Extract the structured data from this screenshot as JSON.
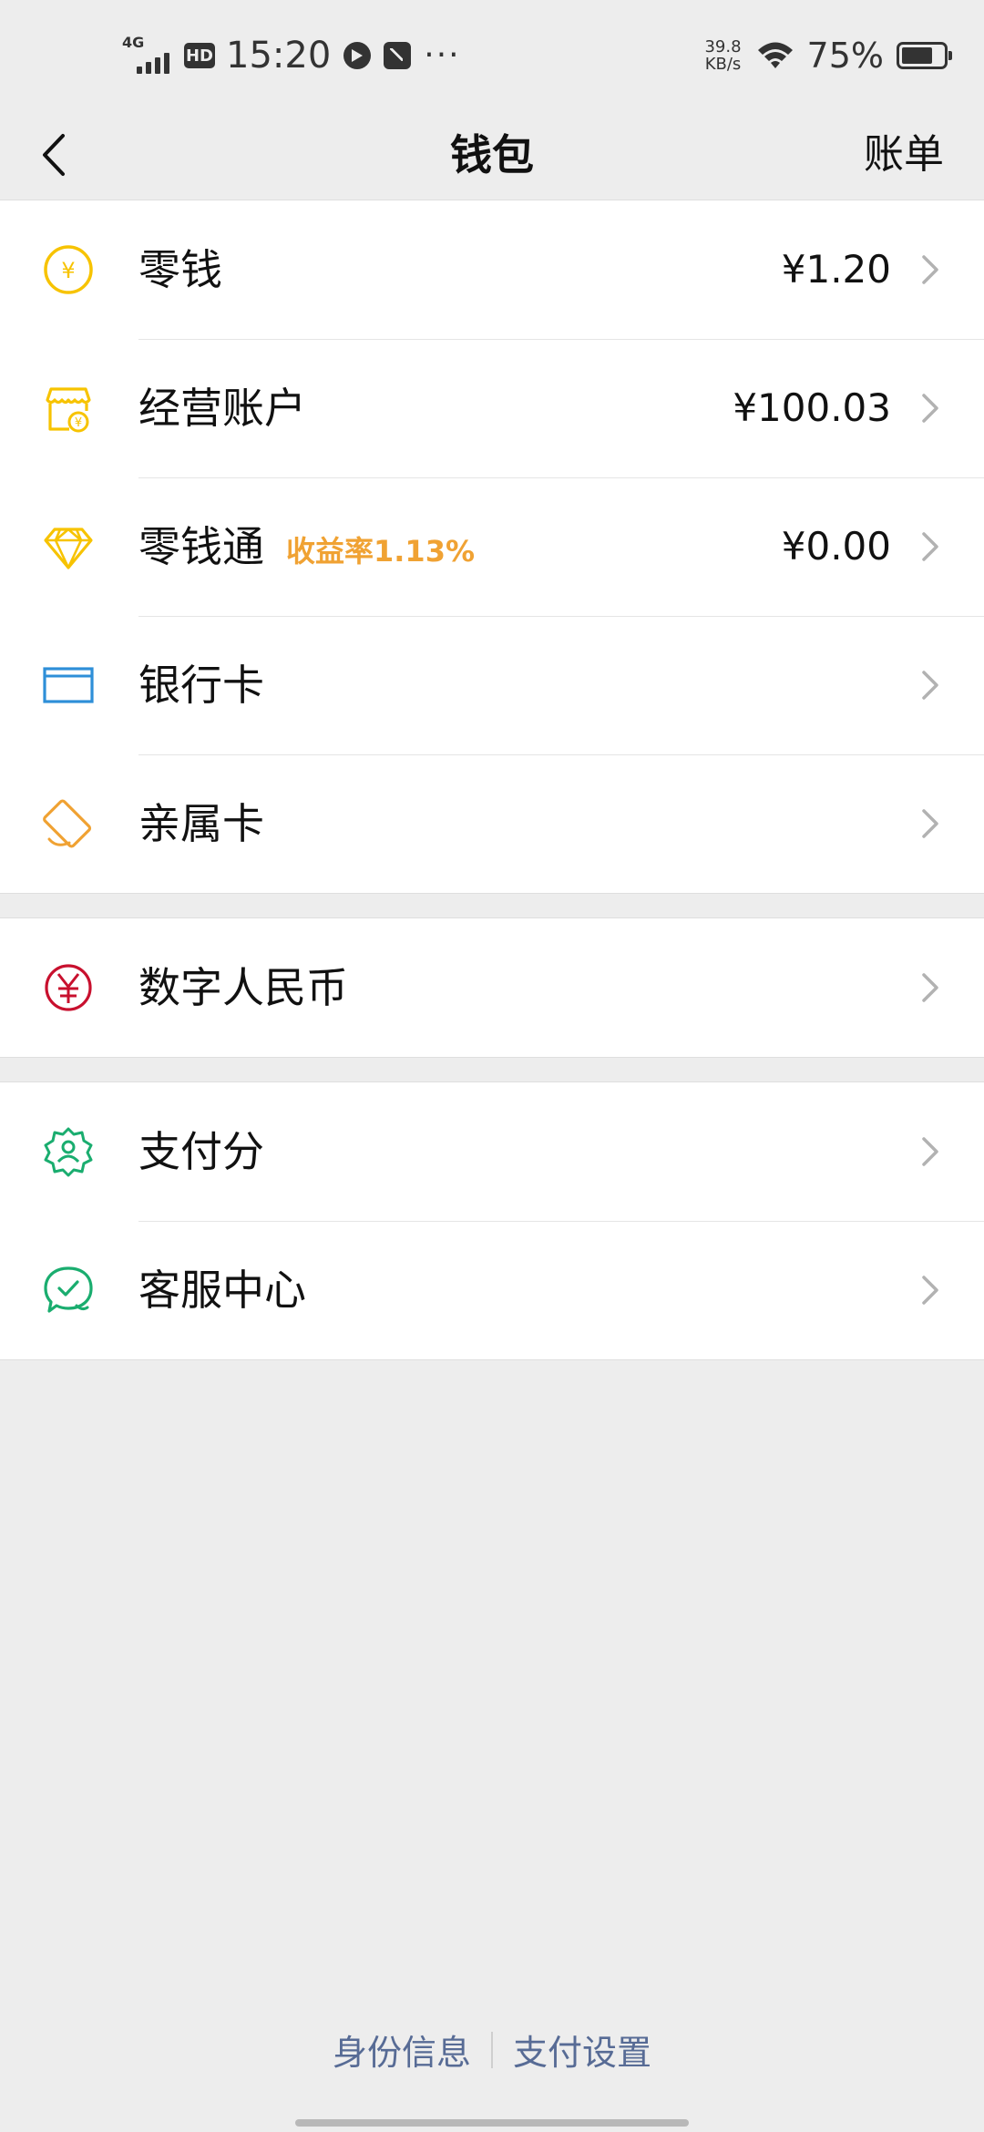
{
  "status_bar": {
    "network": "4G",
    "hd": "HD",
    "time": "15:20",
    "more": "···",
    "speed_value": "39.8",
    "speed_unit": "KB/s",
    "battery_pct": "75%",
    "battery_level": 0.75
  },
  "nav": {
    "title": "钱包",
    "right_link": "账单"
  },
  "groups": {
    "main": {
      "items": [
        {
          "label": "零钱",
          "value": "¥1.20",
          "icon": "coin-icon"
        },
        {
          "label": "经营账户",
          "value": "¥100.03",
          "icon": "business-account-icon"
        },
        {
          "label": "零钱通",
          "badge": "收益率1.13%",
          "value": "¥0.00",
          "icon": "diamond-icon"
        },
        {
          "label": "银行卡",
          "icon": "bank-card-icon"
        },
        {
          "label": "亲属卡",
          "icon": "family-card-icon"
        }
      ]
    },
    "digital": {
      "items": [
        {
          "label": "数字人民币",
          "icon": "digital-rmb-icon"
        }
      ]
    },
    "services": {
      "items": [
        {
          "label": "支付分",
          "icon": "pay-score-icon"
        },
        {
          "label": "客服中心",
          "icon": "customer-service-icon"
        }
      ]
    }
  },
  "footer": {
    "identity": "身份信息",
    "settings": "支付设置"
  },
  "colors": {
    "background": "#ededed",
    "coin": "#f7c300",
    "bank_card": "#2e8fd8",
    "family_card": "#f0a233",
    "digital_rmb": "#c8102e",
    "green": "#07c160",
    "badge": "#f0a233",
    "link": "#576b95"
  }
}
